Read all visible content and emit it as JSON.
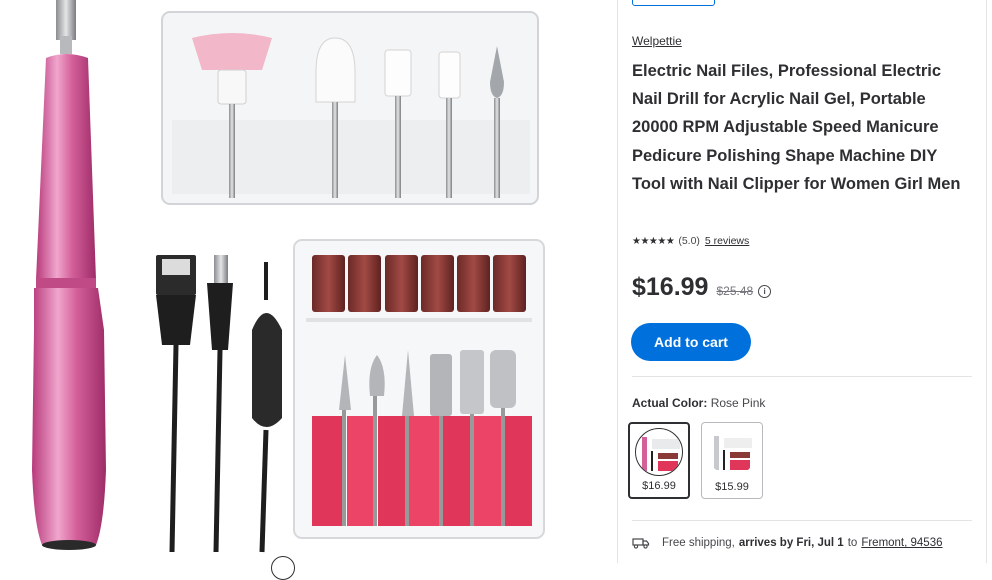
{
  "product": {
    "brand": "Welpettie",
    "title": "Electric Nail Files, Professional Electric Nail Drill for Acrylic Nail Gel, Portable 20000 RPM Adjustable Speed Manicure Pedicure Polishing Shape Machine DIY Tool with Nail Clipper for Women Girl Men",
    "stars": "★★★★★",
    "rating_text": "(5.0)",
    "reviews_link": "5 reviews",
    "price": "$16.99",
    "was_price": "$25.48",
    "info_icon_glyph": "i",
    "add_to_cart": "Add to cart"
  },
  "color": {
    "label": "Actual Color:",
    "value": "Rose Pink",
    "options": [
      {
        "price": "$16.99",
        "selected": true
      },
      {
        "price": "$15.99",
        "selected": false
      }
    ]
  },
  "shipping": {
    "prefix": "Free shipping,",
    "arrives": "arrives by Fri, Jul 1",
    "to_text": "to",
    "location": "Fremont, 94536"
  },
  "icons": [
    "truck-icon",
    "info-icon",
    "star-icon"
  ],
  "colors": {
    "accent": "#0071dc",
    "text": "#2e2f32",
    "product_pink": "#d4609a",
    "sanding_band": "#8a3a36",
    "holder_red": "#e0365a"
  }
}
